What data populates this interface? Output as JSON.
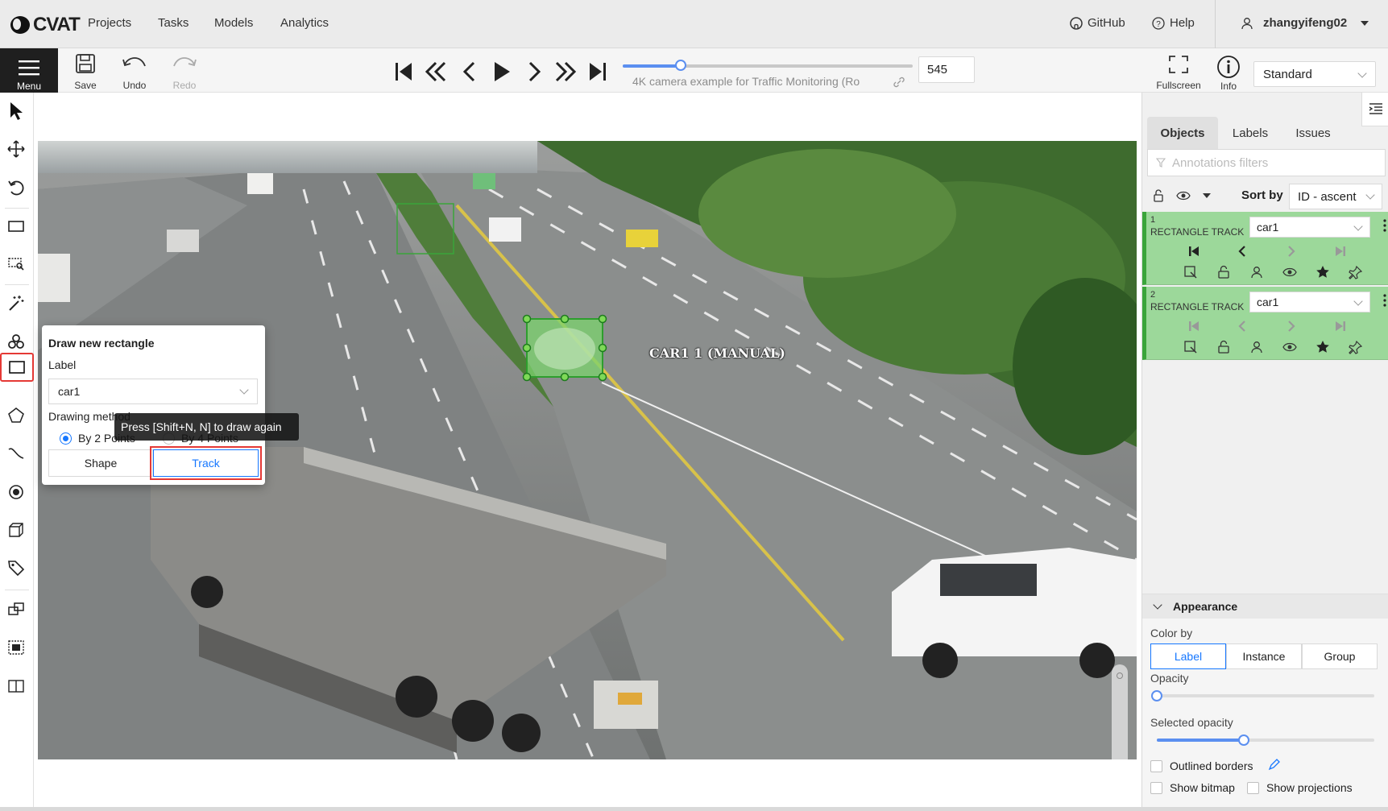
{
  "topnav": {
    "logo_text": "CVAT",
    "links": [
      "Projects",
      "Tasks",
      "Models",
      "Analytics"
    ],
    "github": "GitHub",
    "help": "Help",
    "user": "zhangyifeng02"
  },
  "toolbar": {
    "menu": "Menu",
    "save": "Save",
    "undo": "Undo",
    "redo": "Redo",
    "job_title": "4K camera example for Traffic Monitoring (Ro",
    "frame": "545",
    "fullscreen": "Fullscreen",
    "info": "Info",
    "workspace": "Standard",
    "player_progress": 0.2
  },
  "canvas": {
    "object_label": "CAR1 1 (MANUAL)"
  },
  "popover": {
    "title": "Draw new rectangle",
    "label_caption": "Label",
    "label_value": "car1",
    "method_caption": "Drawing method",
    "method_options": [
      "By 2 Points",
      "By 4 Points"
    ],
    "selected_method": "By 2 Points",
    "shape_btn": "Shape",
    "track_btn": "Track",
    "tooltip": "Press [Shift+N, N] to draw again"
  },
  "sidebar": {
    "tabs": [
      "Objects",
      "Labels",
      "Issues"
    ],
    "active_tab": "Objects",
    "filter_placeholder": "Annotations filters",
    "sort_by": "Sort by",
    "sort_value": "ID - ascent",
    "objects": [
      {
        "id": "1",
        "type": "RECTANGLE TRACK",
        "label": "car1"
      },
      {
        "id": "2",
        "type": "RECTANGLE TRACK",
        "label": "car1"
      }
    ],
    "appearance": {
      "title": "Appearance",
      "color_by": "Color by",
      "color_options": [
        "Label",
        "Instance",
        "Group"
      ],
      "color_selected": "Label",
      "opacity": "Opacity",
      "opacity_value": 0.0,
      "selected_opacity": "Selected opacity",
      "selected_opacity_value": 0.4,
      "outlined_borders": "Outlined borders",
      "show_bitmap": "Show bitmap",
      "show_projections": "Show projections"
    }
  },
  "colors": {
    "accent": "#1677ff",
    "object_green": "#9cd89a",
    "highlight_red": "#e53935"
  }
}
